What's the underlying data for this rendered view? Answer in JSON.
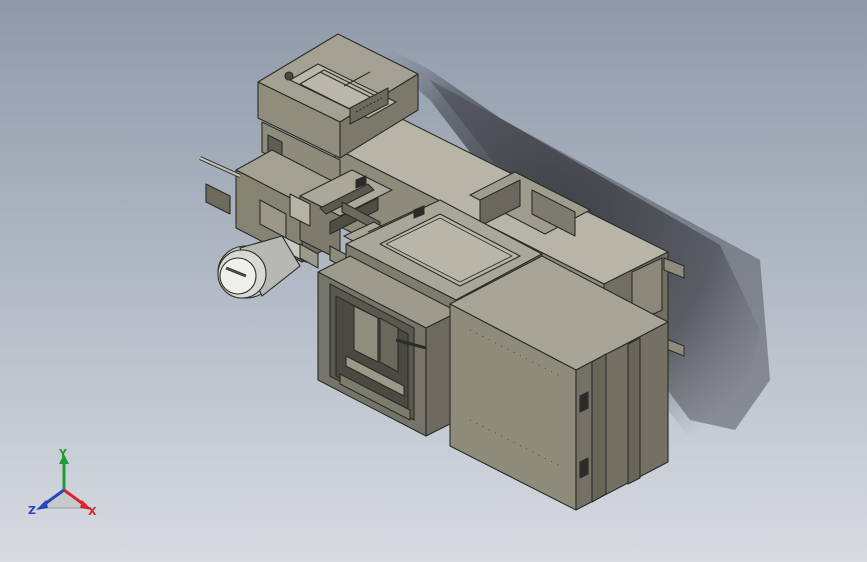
{
  "viewport": {
    "background_top": "#8f9aa9",
    "background_bottom": "#d7dbe2"
  },
  "model": {
    "body_color": "#8d8b7a",
    "edge_color": "#2b2b28",
    "accent_silver": "#c9c9c3"
  },
  "triad": {
    "x_label": "X",
    "y_label": "Y",
    "z_label": "Z",
    "x_color": "#d7262a",
    "y_color": "#1f9a3c",
    "z_color": "#2647b8"
  }
}
